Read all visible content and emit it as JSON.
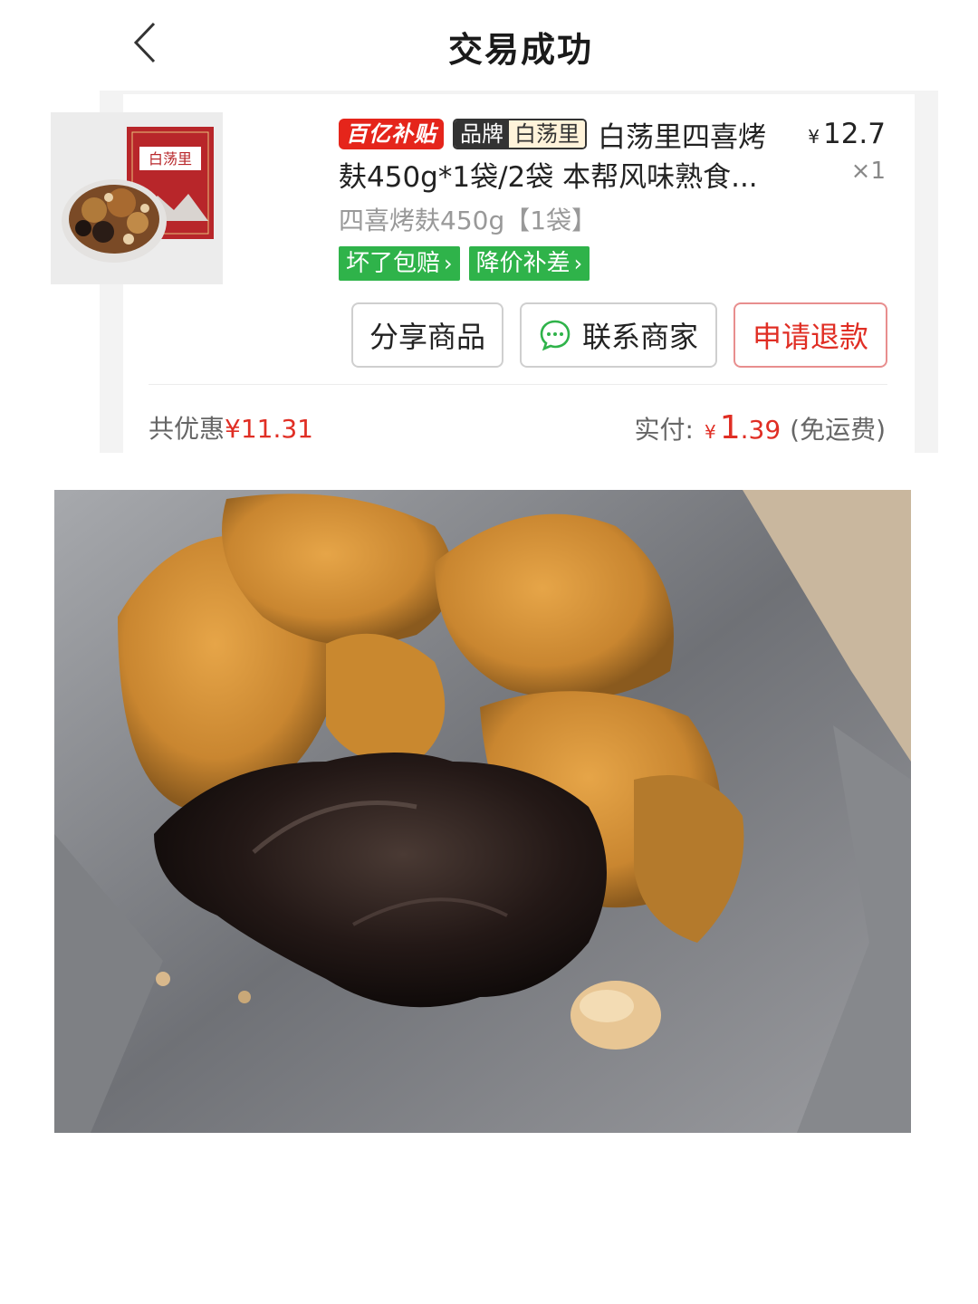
{
  "header": {
    "title": "交易成功"
  },
  "order": {
    "badge_subsidy": "百亿补贴",
    "brand_key": "品牌",
    "brand_value": "白荡里",
    "product_title_line1": "白荡里四喜烤",
    "product_title_line2": "麸450g*1袋/2袋 本帮风味熟食...",
    "price_symbol": "¥",
    "price": "12.7",
    "quantity": "×1",
    "spec": "四喜烤麸450g【1袋】",
    "tags": [
      "坏了包赔",
      "降价补差"
    ],
    "packaging_text": "白荡里"
  },
  "actions": {
    "share": "分享商品",
    "contact": "联系商家",
    "refund": "申请退款"
  },
  "summary": {
    "discount_label": "共优惠",
    "discount_amount": "¥11.31",
    "paid_label": "实付:",
    "paid_symbol": "¥",
    "paid_int": "1",
    "paid_dec": ".39",
    "shipping": "(免运费)"
  },
  "colors": {
    "accent_red": "#e02e24",
    "tag_green": "#2fb34a"
  }
}
